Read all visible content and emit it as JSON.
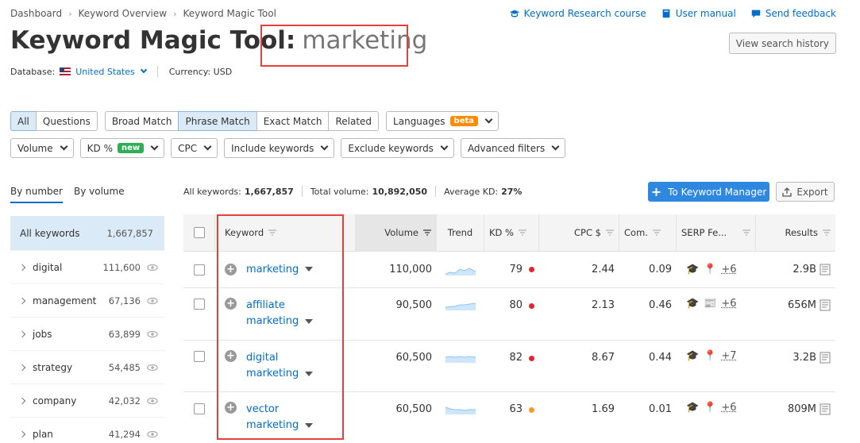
{
  "breadcrumb": [
    "Dashboard",
    "Keyword Overview",
    "Keyword Magic Tool"
  ],
  "toplinks": {
    "course": "Keyword Research course",
    "manual": "User manual",
    "feedback": "Send feedback"
  },
  "title": {
    "prefix": "Keyword Magic Tool:",
    "keyword": "marketing"
  },
  "history_button": "View search history",
  "database": {
    "label": "Database:",
    "value": "United States",
    "currency": "Currency: USD"
  },
  "match_tabs": {
    "group1": [
      "All",
      "Questions"
    ],
    "group2": [
      "Broad Match",
      "Phrase Match",
      "Exact Match",
      "Related"
    ],
    "active": [
      "All",
      "Phrase Match"
    ],
    "languages": "Languages",
    "beta": "beta"
  },
  "filters": {
    "volume": "Volume",
    "kd": "KD %",
    "kd_badge": "new",
    "cpc": "CPC",
    "include": "Include keywords",
    "exclude": "Exclude keywords",
    "advanced": "Advanced filters"
  },
  "left_tabs": [
    "By number",
    "By volume"
  ],
  "left_list": {
    "all": {
      "name": "All keywords",
      "count": "1,667,857"
    },
    "items": [
      {
        "name": "digital",
        "count": "111,600"
      },
      {
        "name": "management",
        "count": "67,136"
      },
      {
        "name": "jobs",
        "count": "63,899"
      },
      {
        "name": "strategy",
        "count": "54,485"
      },
      {
        "name": "company",
        "count": "42,032"
      },
      {
        "name": "plan",
        "count": "41,294"
      }
    ]
  },
  "stats": {
    "all_label": "All keywords:",
    "all_value": "1,667,857",
    "vol_label": "Total volume:",
    "vol_value": "10,892,050",
    "kd_label": "Average KD:",
    "kd_value": "27%"
  },
  "to_keyword_manager": "To Keyword Manager",
  "export": "Export",
  "columns": [
    "Keyword",
    "Volume",
    "Trend",
    "KD %",
    "CPC $",
    "Com.",
    "SERP Fe...",
    "Results"
  ],
  "rows": [
    {
      "kw1": "marketing",
      "kw2": "",
      "volume": "110,000",
      "kd": "79",
      "kd_color": "#e0262e",
      "cpc": "2.44",
      "com": "0.09",
      "serp_more": "+6",
      "results": "2.9B"
    },
    {
      "kw1": "affiliate",
      "kw2": "marketing",
      "volume": "90,500",
      "kd": "80",
      "kd_color": "#e0262e",
      "cpc": "2.13",
      "com": "0.46",
      "serp_more": "+6",
      "results": "656M"
    },
    {
      "kw1": "digital",
      "kw2": "marketing",
      "volume": "60,500",
      "kd": "82",
      "kd_color": "#e0262e",
      "cpc": "8.67",
      "com": "0.44",
      "serp_more": "+7",
      "results": "3.2B"
    },
    {
      "kw1": "vector",
      "kw2": "marketing",
      "volume": "60,500",
      "kd": "63",
      "kd_color": "#f59a23",
      "cpc": "1.69",
      "com": "0.01",
      "serp_more": "+6",
      "results": "809M"
    }
  ],
  "colors": {
    "accent": "#006dca",
    "button": "#2f88e0",
    "highlight": "#e6403a"
  }
}
